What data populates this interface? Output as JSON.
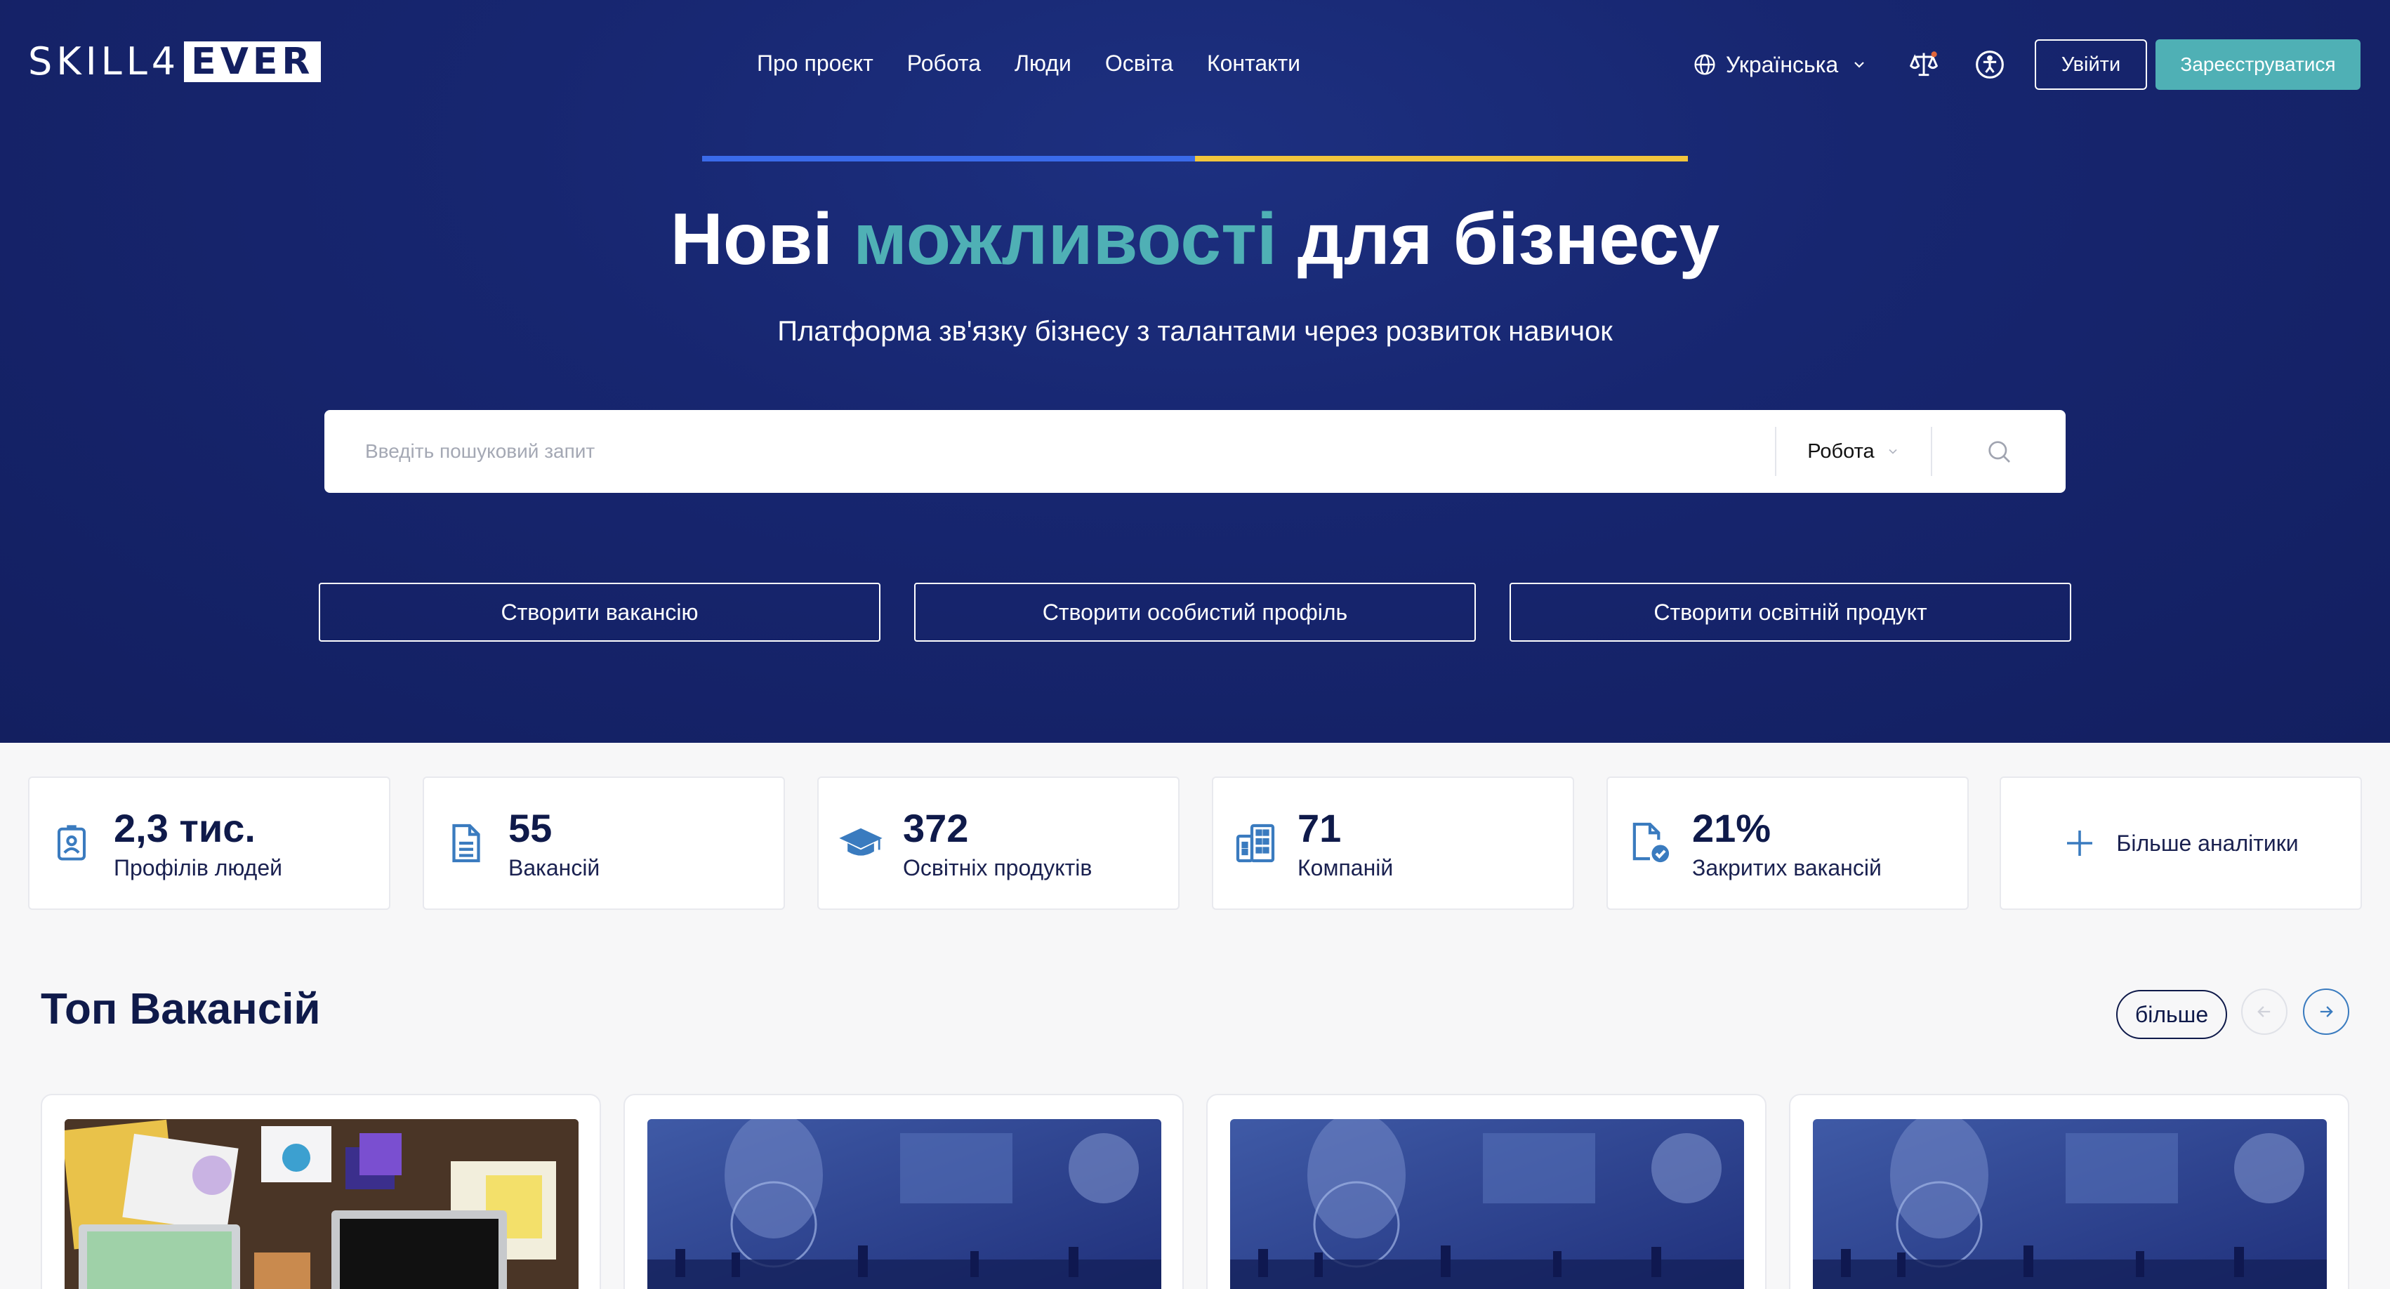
{
  "header": {
    "logo_left": "SKILL4",
    "logo_right": "EVER",
    "nav": [
      "Про проєкт",
      "Робота",
      "Люди",
      "Освіта",
      "Контакти"
    ],
    "language": "Українська",
    "login": "Увійти",
    "register": "Зареєструватися"
  },
  "hero": {
    "title_before": "Нові ",
    "title_accent": "можливості",
    "title_after": " для бізнесу",
    "subtitle": "Платформа зв'язку бізнесу з талантами через розвиток навичок",
    "search_placeholder": "Введіть пошуковий запит",
    "search_category": "Робота",
    "cta": [
      "Створити вакансію",
      "Створити особистий профіль",
      "Створити освітній продукт"
    ]
  },
  "stats": [
    {
      "value": "2,3 тис.",
      "label": "Профілів людей",
      "icon": "profile-card-icon"
    },
    {
      "value": "55",
      "label": "Вакансій",
      "icon": "document-icon"
    },
    {
      "value": "372",
      "label": "Освітніх продуктів",
      "icon": "graduation-cap-icon"
    },
    {
      "value": "71",
      "label": "Компаній",
      "icon": "building-icon"
    },
    {
      "value": "21%",
      "label": "Закритих вакансій",
      "icon": "file-check-icon"
    }
  ],
  "more_analytics": "Більше аналітики",
  "top_vacancies": {
    "title": "Топ Вакансій",
    "more": "більше",
    "cards": [
      {
        "image": "office-desk-photo"
      },
      {
        "image": "business-tech-photo"
      },
      {
        "image": "business-tech-photo"
      },
      {
        "image": "business-tech-photo"
      }
    ]
  },
  "colors": {
    "hero_bg": "#172670",
    "accent": "#4fb0b5",
    "flag_blue": "#3a6bea",
    "flag_yellow": "#f2c53c",
    "text_dark": "#0f1a4a"
  }
}
